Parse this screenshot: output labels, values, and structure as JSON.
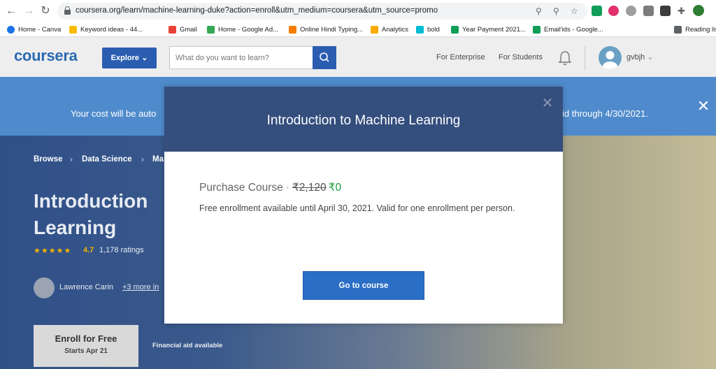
{
  "browser": {
    "url": "coursera.org/learn/machine-learning-duke?action=enroll&utm_medium=coursera&utm_source=promo",
    "bookmarks": [
      {
        "label": "Home - Canva",
        "color": "#1a73e8"
      },
      {
        "label": "Keyword ideas - 44...",
        "color": "#fbbc04"
      },
      {
        "label": "Gmail",
        "color": "#ea4335"
      },
      {
        "label": "Home - Google Ad...",
        "color": "#34a853"
      },
      {
        "label": "Online Hindi Typing...",
        "color": "#f57c00"
      },
      {
        "label": "Analytics",
        "color": "#f9ab00"
      },
      {
        "label": "bold",
        "color": "#00bcd4"
      },
      {
        "label": "Year Payment 2021...",
        "color": "#0f9d58"
      },
      {
        "label": "Email'ids - Google...",
        "color": "#0f9d58"
      },
      {
        "label": "Reading list",
        "color": "#5f6368"
      }
    ]
  },
  "header": {
    "logo": "coursera",
    "explore_label": "Explore",
    "search_placeholder": "What do you want to learn?",
    "enterprise_link": "For Enterprise",
    "students_link": "For Students",
    "username": "gvbjh"
  },
  "banner": {
    "text_left": "Your cost will be auto",
    "text_right": "id through 4/30/2021."
  },
  "hero": {
    "breadcrumbs": [
      "Browse",
      "Data Science",
      "Ma"
    ],
    "title_line1": "Introduction",
    "title_line2": "Learning",
    "stars": "★★★★★",
    "rating": "4.7",
    "ratings_count": "1,178 ratings",
    "instructor": "Lawrence Carin",
    "more_instructors": "+3 more in",
    "enroll_label": "Enroll for Free",
    "enroll_sub": "Starts Apr 21",
    "financial_aid": "Financial aid available"
  },
  "modal": {
    "title": "Introduction to Machine Learning",
    "purchase_label": "Purchase Course",
    "separator": "·",
    "old_price": "₹2,120",
    "new_price": "₹0",
    "description": "Free enrollment available until April 30, 2021. Valid for one enrollment per person.",
    "button_label": "Go to course"
  }
}
